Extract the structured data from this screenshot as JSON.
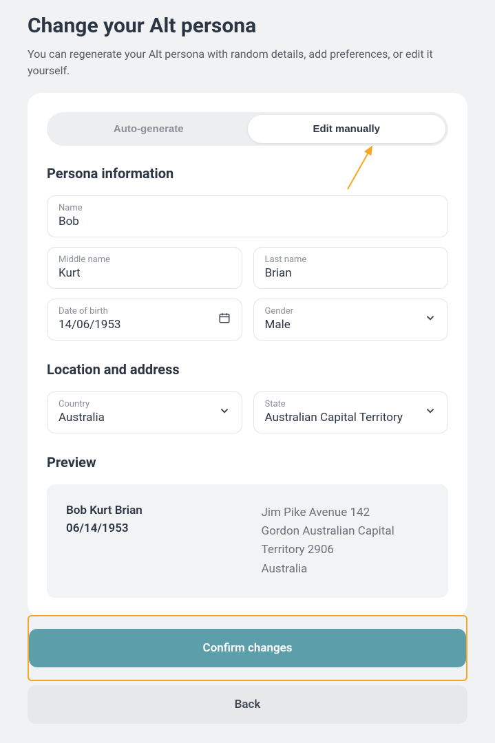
{
  "header": {
    "title": "Change your Alt persona",
    "subtitle": "You can regenerate your Alt persona with random details, add preferences, or edit it yourself."
  },
  "tabs": {
    "auto_generate": "Auto-generate",
    "edit_manually": "Edit manually"
  },
  "sections": {
    "persona_info": "Persona information",
    "location": "Location and address",
    "preview": "Preview"
  },
  "fields": {
    "name": {
      "label": "Name",
      "value": "Bob"
    },
    "middle_name": {
      "label": "Middle name",
      "value": "Kurt"
    },
    "last_name": {
      "label": "Last name",
      "value": "Brian"
    },
    "dob": {
      "label": "Date of birth",
      "value": "14/06/1953"
    },
    "gender": {
      "label": "Gender",
      "value": "Male"
    },
    "country": {
      "label": "Country",
      "value": "Australia"
    },
    "state": {
      "label": "State",
      "value": "Australian Capital Territory"
    }
  },
  "preview": {
    "full_name": "Bob Kurt Brian",
    "dob": "06/14/1953",
    "address_line1": "Jim Pike Avenue 142",
    "address_line2": "Gordon Australian Capital Territory 2906",
    "address_line3": "Australia"
  },
  "buttons": {
    "confirm": "Confirm changes",
    "back": "Back"
  }
}
